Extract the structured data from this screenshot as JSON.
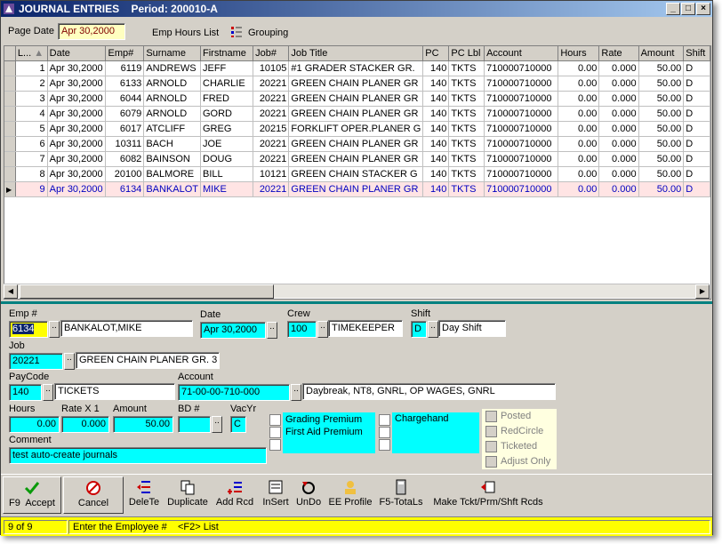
{
  "window": {
    "title": "JOURNAL ENTRIES",
    "period": "Period: 200010-A",
    "controls": [
      "_",
      "□",
      "×"
    ]
  },
  "top": {
    "page_date_label": "Page Date",
    "page_date": "Apr 30,2000",
    "emp_hours_list": "Emp Hours List",
    "grouping": "Grouping"
  },
  "grid": {
    "columns": [
      "L...",
      "Date",
      "Emp#",
      "Surname",
      "Firstname",
      "Job#",
      "Job Title",
      "PC",
      "PC Lbl",
      "Account",
      "Hours",
      "Rate",
      "Amount",
      "Shift"
    ],
    "rows": [
      [
        "1",
        "Apr 30,2000",
        "6119",
        "ANDREWS",
        "JEFF",
        "10105",
        "#1 GRADER STACKER GR.",
        "140",
        "TKTS",
        "710000710000",
        "0.00",
        "0.000",
        "50.00",
        "D"
      ],
      [
        "2",
        "Apr 30,2000",
        "6133",
        "ARNOLD",
        "CHARLIE",
        "20221",
        "GREEN CHAIN PLANER GR",
        "140",
        "TKTS",
        "710000710000",
        "0.00",
        "0.000",
        "50.00",
        "D"
      ],
      [
        "3",
        "Apr 30,2000",
        "6044",
        "ARNOLD",
        "FRED",
        "20221",
        "GREEN CHAIN PLANER GR",
        "140",
        "TKTS",
        "710000710000",
        "0.00",
        "0.000",
        "50.00",
        "D"
      ],
      [
        "4",
        "Apr 30,2000",
        "6079",
        "ARNOLD",
        "GORD",
        "20221",
        "GREEN CHAIN PLANER GR",
        "140",
        "TKTS",
        "710000710000",
        "0.00",
        "0.000",
        "50.00",
        "D"
      ],
      [
        "5",
        "Apr 30,2000",
        "6017",
        "ATCLIFF",
        "GREG",
        "20215",
        "FORKLIFT OPER.PLANER G",
        "140",
        "TKTS",
        "710000710000",
        "0.00",
        "0.000",
        "50.00",
        "D"
      ],
      [
        "6",
        "Apr 30,2000",
        "10311",
        "BACH",
        "JOE",
        "20221",
        "GREEN CHAIN PLANER GR",
        "140",
        "TKTS",
        "710000710000",
        "0.00",
        "0.000",
        "50.00",
        "D"
      ],
      [
        "7",
        "Apr 30,2000",
        "6082",
        "BAINSON",
        "DOUG",
        "20221",
        "GREEN CHAIN PLANER GR",
        "140",
        "TKTS",
        "710000710000",
        "0.00",
        "0.000",
        "50.00",
        "D"
      ],
      [
        "8",
        "Apr 30,2000",
        "20100",
        "BALMORE",
        "BILL",
        "10121",
        "GREEN CHAIN STACKER G",
        "140",
        "TKTS",
        "710000710000",
        "0.00",
        "0.000",
        "50.00",
        "D"
      ],
      [
        "9",
        "Apr 30,2000",
        "6134",
        "BANKALOT",
        "MIKE",
        "20221",
        "GREEN CHAIN PLANER GR",
        "140",
        "TKTS",
        "710000710000",
        "0.00",
        "0.000",
        "50.00",
        "D"
      ]
    ]
  },
  "form": {
    "emp_label": "Emp #",
    "emp": "6134",
    "emp_name": "BANKALOT,MIKE",
    "date_label": "Date",
    "date": "Apr 30,2000",
    "crew_label": "Crew",
    "crew": "100",
    "crew_name": "TIMEKEEPER",
    "shift_label": "Shift",
    "shift": "D",
    "shift_name": "Day Shift",
    "job_label": "Job",
    "job": "20221",
    "job_name": "GREEN CHAIN PLANER GR. 3",
    "paycode_label": "PayCode",
    "paycode": "140",
    "paycode_name": "TICKETS",
    "account_label": "Account",
    "account": "71-00-00-710-000",
    "account_name": "Daybreak, NT8, GNRL, OP WAGES, GNRL",
    "hours_label": "Hours",
    "hours": "0.00",
    "rate_label": "Rate X 1",
    "rate": "0.000",
    "amount_label": "Amount",
    "amount": "50.00",
    "bd_label": "BD #",
    "bd": "",
    "vacyr_label": "VacYr",
    "vacyr": "C",
    "comment_label": "Comment",
    "comment": "test auto-create journals",
    "premiums": [
      "Grading Premium",
      "First Aid Premium",
      ""
    ],
    "chargehand": [
      "Chargehand",
      "",
      ""
    ],
    "flags": [
      "Posted",
      "RedCircle",
      "Ticketed",
      "Adjust Only"
    ]
  },
  "toolbar": {
    "accept": "F9  Accept",
    "cancel": "Cancel",
    "delete": "DeleTe",
    "duplicate": "Duplicate",
    "add": "Add Rcd",
    "insert": "InSert",
    "undo": "UnDo",
    "profile": "EE Profile",
    "totals": "F5-TotaLs",
    "make": "Make Tckt/Prm/Shft Rcds"
  },
  "status": {
    "count": "9 of 9",
    "message": "Enter the Employee #    <F2> List"
  },
  "colors": {
    "titlebar": "#0a246a",
    "highlight": "#00ffff",
    "status": "#ffff00",
    "current_row": "#ffe4e4"
  }
}
